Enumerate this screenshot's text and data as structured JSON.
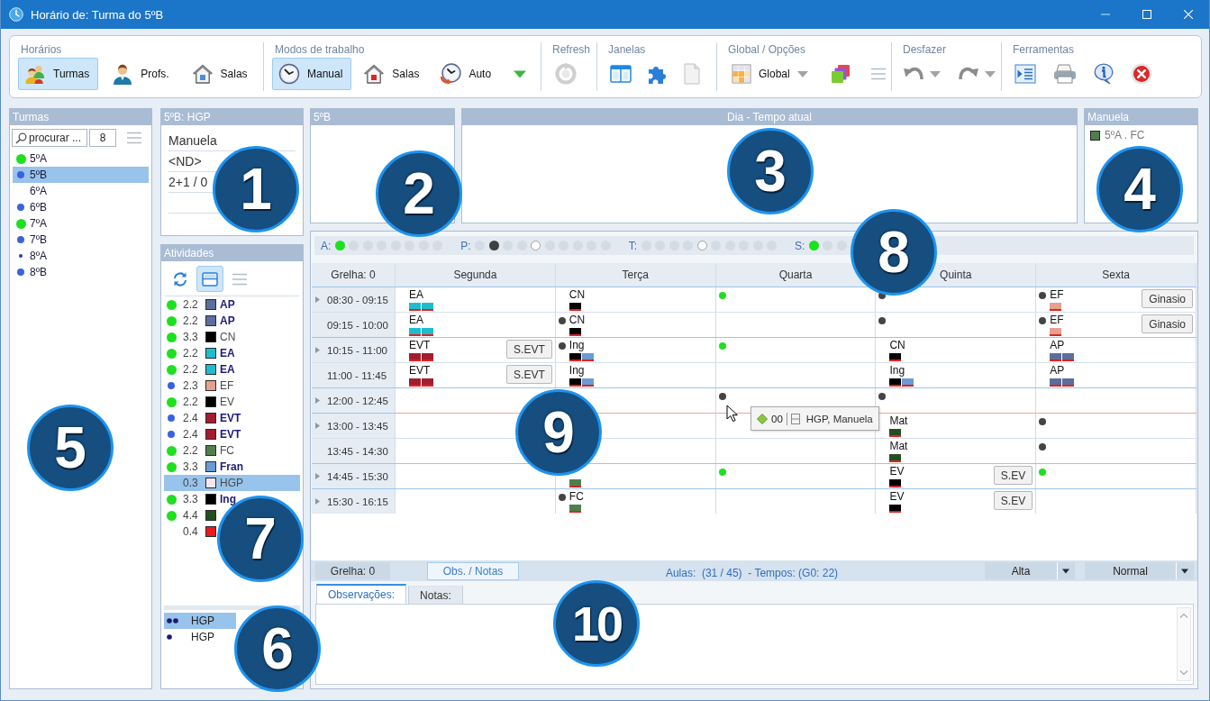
{
  "window": {
    "title": "Horário de: Turma do 5ºB"
  },
  "ribbon": [
    {
      "title": "Horários",
      "buttons": [
        {
          "label": "Turmas",
          "selected": true
        },
        {
          "label": "Profs.",
          "selected": false
        },
        {
          "label": "Salas",
          "selected": false
        }
      ]
    },
    {
      "title": "Modos de trabalho",
      "buttons": [
        {
          "label": "Manual",
          "selected": true
        },
        {
          "label": "Salas",
          "selected": false
        },
        {
          "label": "Auto",
          "selected": false
        }
      ]
    },
    {
      "title": "Refresh"
    },
    {
      "title": "Janelas"
    },
    {
      "title": "Global / Opções",
      "buttons": [
        {
          "label": "Global"
        }
      ]
    },
    {
      "title": "Desfazer"
    },
    {
      "title": "Ferramentas"
    }
  ],
  "classes_panel": {
    "title": "Turmas",
    "callout": "5",
    "search": {
      "placeholder": "procurar ..."
    },
    "count": "8",
    "items": [
      {
        "label": "5ºA",
        "selected": false,
        "dot": {
          "kind": "large",
          "color": "#1ee01e"
        }
      },
      {
        "label": "5ºB",
        "selected": true,
        "dot": {
          "kind": "medium",
          "color": "#3a62e0"
        }
      },
      {
        "label": "6ºA",
        "selected": false
      },
      {
        "label": "6ºB",
        "selected": false,
        "dot": {
          "kind": "medium",
          "color": "#3a62e0"
        }
      },
      {
        "label": "7ºA",
        "selected": false,
        "dot": {
          "kind": "large",
          "color": "#1ee01e"
        }
      },
      {
        "label": "7ºB",
        "selected": false,
        "dot": {
          "kind": "medium",
          "color": "#3a62e0"
        }
      },
      {
        "label": "8ºA",
        "selected": false,
        "dot": {
          "kind": "tiny",
          "color": "#2a3a9a"
        }
      },
      {
        "label": "8ºB",
        "selected": false,
        "dot": {
          "kind": "medium",
          "color": "#3a62e0"
        }
      }
    ]
  },
  "class_info": {
    "title": "5ºB: HGP",
    "callout": "1",
    "lines": [
      "Manuela",
      "<ND>",
      "2+1 / 0"
    ]
  },
  "activities": {
    "title": "Atividades",
    "callout": "7",
    "teachers_callout": "6",
    "toolbar": [
      {
        "selected": false
      },
      {
        "selected": true
      },
      {
        "selected": false
      }
    ],
    "items": [
      {
        "dot": {
          "kind": "large",
          "color": "#1ee01e"
        },
        "value": "2.2",
        "color": "#5d6d9d",
        "label": "AP",
        "bold": true,
        "selected": false
      },
      {
        "dot": {
          "kind": "large",
          "color": "#1ee01e"
        },
        "value": "2.2",
        "color": "#5d6d9d",
        "label": "AP",
        "bold": true,
        "selected": false
      },
      {
        "dot": {
          "kind": "large",
          "color": "#1ee01e"
        },
        "value": "3.3",
        "color": "#000000",
        "label": "CN",
        "bold": false,
        "selected": false
      },
      {
        "dot": {
          "kind": "large",
          "color": "#1ee01e"
        },
        "value": "2.2",
        "color": "#1fbcd0",
        "label": "EA",
        "bold": true,
        "selected": false
      },
      {
        "dot": {
          "kind": "large",
          "color": "#1ee01e"
        },
        "value": "2.2",
        "color": "#1fbcd0",
        "label": "EA",
        "bold": true,
        "selected": false
      },
      {
        "dot": {
          "kind": "medium",
          "color": "#3a62e0"
        },
        "value": "2.3",
        "color": "#e5a090",
        "label": "EF",
        "bold": false,
        "selected": false
      },
      {
        "dot": {
          "kind": "large",
          "color": "#1ee01e"
        },
        "value": "2.2",
        "color": "#000000",
        "label": "EV",
        "bold": false,
        "selected": false
      },
      {
        "dot": {
          "kind": "medium",
          "color": "#3a62e0"
        },
        "value": "2.4",
        "color": "#a31c30",
        "label": "EVT",
        "bold": true,
        "selected": false
      },
      {
        "dot": {
          "kind": "medium",
          "color": "#3a62e0"
        },
        "value": "2.4",
        "color": "#a31c30",
        "label": "EVT",
        "bold": true,
        "selected": false
      },
      {
        "dot": {
          "kind": "large",
          "color": "#1ee01e"
        },
        "value": "2.2",
        "color": "#4f7f4f",
        "label": "FC",
        "bold": false,
        "selected": false
      },
      {
        "dot": {
          "kind": "large",
          "color": "#1ee01e"
        },
        "value": "3.3",
        "color": "#6a9bd6",
        "label": "Fran",
        "bold": true,
        "selected": false
      },
      {
        "value": "0.3",
        "color": "#f5e6ee",
        "label": "HGP",
        "bold": false,
        "selected": true
      },
      {
        "dot": {
          "kind": "large",
          "color": "#1ee01e"
        },
        "value": "3.3",
        "color": "#000000",
        "label": "Ing",
        "bold": true,
        "selected": false
      },
      {
        "dot": {
          "kind": "large",
          "color": "#1ee01e"
        },
        "value": "4.4",
        "color": "#224f22",
        "selected": false
      },
      {
        "value": "0.4",
        "color": "#e81a1a",
        "selected": false
      }
    ],
    "teachers": [
      {
        "label": "HGP",
        "kind": "double",
        "selected": true
      },
      {
        "label": "HGP",
        "kind": "single",
        "selected": false
      }
    ]
  },
  "group_panel": {
    "title": "5ºB",
    "callout": "2"
  },
  "day_panel": {
    "title": "Dia - Tempo atual",
    "callout": "3"
  },
  "teacher_panel": {
    "title": "Manuela",
    "callout": "4",
    "items": [
      {
        "label": "5ºA . FC",
        "color": "#4f7f4f"
      }
    ]
  },
  "schedule": {
    "occupancy": {
      "callout": "8",
      "groups": [
        {
          "label": "A:",
          "dots": [
            {
              "color": "#1ee01e",
              "hollow": false
            },
            {
              "color": "#d5dbe3",
              "hollow": false
            },
            {
              "color": "#d5dbe3",
              "hollow": false
            },
            {
              "color": "#d5dbe3",
              "hollow": false
            },
            {
              "color": "#d5dbe3",
              "hollow": false
            },
            {
              "color": "#d5dbe3",
              "hollow": false
            },
            {
              "color": "#d5dbe3",
              "hollow": false
            },
            {
              "color": "#d5dbe3",
              "hollow": false
            }
          ]
        },
        {
          "label": "P:",
          "dots": [
            {
              "color": "#d5dbe3",
              "hollow": false
            },
            {
              "color": "#404040",
              "hollow": false
            },
            {
              "color": "#d5dbe3",
              "hollow": false
            },
            {
              "color": "#d5dbe3",
              "hollow": false
            },
            {
              "color": "#ffffff",
              "hollow": true
            },
            {
              "color": "#d5dbe3",
              "hollow": false
            },
            {
              "color": "#d5dbe3",
              "hollow": false
            },
            {
              "color": "#d5dbe3",
              "hollow": false
            },
            {
              "color": "#d5dbe3",
              "hollow": false
            },
            {
              "color": "#d5dbe3",
              "hollow": false
            }
          ]
        },
        {
          "label": "T:",
          "dots": [
            {
              "color": "#d5dbe3",
              "hollow": false
            },
            {
              "color": "#d5dbe3",
              "hollow": false
            },
            {
              "color": "#d5dbe3",
              "hollow": false
            },
            {
              "color": "#d5dbe3",
              "hollow": false
            },
            {
              "color": "#ffffff",
              "hollow": true
            },
            {
              "color": "#d5dbe3",
              "hollow": false
            },
            {
              "color": "#d5dbe3",
              "hollow": false
            },
            {
              "color": "#d5dbe3",
              "hollow": false
            },
            {
              "color": "#d5dbe3",
              "hollow": false
            },
            {
              "color": "#d5dbe3",
              "hollow": false
            }
          ]
        },
        {
          "label": "S:",
          "dots": [
            {
              "color": "#1ee01e",
              "hollow": false
            },
            {
              "color": "#d5dbe3",
              "hollow": false
            },
            {
              "color": "#d5dbe3",
              "hollow": false
            }
          ]
        }
      ]
    },
    "grid": {
      "callout": "9",
      "corner": "Grelha: 0",
      "days": [
        "Segunda",
        "Terça",
        "Quarta",
        "Quinta",
        "Sexta"
      ],
      "rows": [
        {
          "time": "08:30 - 09:15",
          "block_start": true,
          "line_after": false,
          "cells": [
            {
              "subject": "EA",
              "swatches": [
                {
                  "color": "#1fbcd0"
                },
                {
                  "color": "#1fbcd0"
                }
              ]
            },
            {
              "subject": "CN",
              "swatches": [
                {
                  "color": "#000000"
                }
              ]
            },
            {
              "dot": {
                "color": "#22dd22"
              }
            },
            {
              "dot": {
                "color": "#444444"
              }
            },
            {
              "dot": {
                "color": "#444444"
              },
              "subject": "EF",
              "swatches": [
                {
                  "color": "#e5a090"
                }
              ],
              "room": "Ginasio"
            }
          ]
        },
        {
          "time": "09:15 - 10:00",
          "block_start": false,
          "line_after": false,
          "cells": [
            {
              "subject": "EA",
              "swatches": [
                {
                  "color": "#1fbcd0"
                },
                {
                  "color": "#1fbcd0"
                }
              ]
            },
            {
              "dot": {
                "color": "#444444"
              },
              "subject": "CN",
              "swatches": [
                {
                  "color": "#000000"
                }
              ]
            },
            {},
            {
              "dot": {
                "color": "#444444"
              }
            },
            {
              "dot": {
                "color": "#444444"
              },
              "subject": "EF",
              "swatches": [
                {
                  "color": "#e5a090"
                }
              ],
              "room": "Ginasio"
            }
          ]
        },
        {
          "time": "10:15 - 11:00",
          "block_start": true,
          "line_after": false,
          "cells": [
            {
              "subject": "EVT",
              "swatches": [
                {
                  "color": "#a31c30"
                },
                {
                  "color": "#a31c30"
                }
              ],
              "room": "S.EVT"
            },
            {
              "dot": {
                "color": "#444444"
              },
              "subject": "Ing",
              "swatches": [
                {
                  "color": "#000000"
                },
                {
                  "color": "#6a9bd6"
                }
              ]
            },
            {
              "dot": {
                "color": "#22dd22"
              }
            },
            {
              "subject": "CN",
              "swatches": [
                {
                  "color": "#000000"
                }
              ]
            },
            {
              "subject": "AP",
              "swatches": [
                {
                  "color": "#5d6d9d"
                },
                {
                  "color": "#5d6d9d"
                }
              ]
            }
          ]
        },
        {
          "time": "11:00 - 11:45",
          "block_start": false,
          "line_after": false,
          "cells": [
            {
              "subject": "EVT",
              "swatches": [
                {
                  "color": "#a31c30"
                },
                {
                  "color": "#a31c30"
                }
              ],
              "room": "S.EVT"
            },
            {
              "subject": "Ing",
              "swatches": [
                {
                  "color": "#000000"
                },
                {
                  "color": "#6a9bd6"
                }
              ]
            },
            {},
            {
              "subject": "Ing",
              "swatches": [
                {
                  "color": "#000000"
                },
                {
                  "color": "#6a9bd6"
                }
              ]
            },
            {
              "subject": "AP",
              "swatches": [
                {
                  "color": "#5d6d9d"
                },
                {
                  "color": "#5d6d9d"
                }
              ]
            }
          ]
        },
        {
          "time": "12:00 - 12:45",
          "block_start": true,
          "line_after": true,
          "cells": [
            {},
            {},
            {
              "dot": {
                "color": "#444444"
              }
            },
            {
              "dot": {
                "color": "#444444"
              }
            },
            {}
          ]
        },
        {
          "time": "13:00 - 13:45",
          "block_start": true,
          "line_after": false,
          "cells": [
            {},
            {},
            {},
            {
              "subject": "Mat",
              "swatches": [
                {
                  "color": "#224f22"
                }
              ]
            },
            {
              "dot": {
                "color": "#444444"
              }
            }
          ]
        },
        {
          "time": "13:45 - 14:30",
          "block_start": false,
          "line_after": false,
          "cells": [
            {},
            {},
            {},
            {
              "subject": "Mat",
              "swatches": [
                {
                  "color": "#224f22"
                }
              ]
            },
            {
              "dot": {
                "color": "#444444"
              }
            }
          ]
        },
        {
          "time": "14:45 - 15:30",
          "block_start": true,
          "line_after": false,
          "cells": [
            {},
            {
              "swatches": [
                {
                  "color": "#4f7f4f"
                }
              ]
            },
            {
              "dot": {
                "color": "#22dd22"
              }
            },
            {
              "subject": "EV",
              "swatches": [
                {
                  "color": "#000000"
                }
              ],
              "room": "S.EV"
            },
            {
              "dot": {
                "color": "#22dd22"
              }
            }
          ]
        },
        {
          "time": "15:30 - 16:15",
          "block_start": true,
          "line_after": false,
          "cells": [
            {},
            {
              "dot": {
                "color": "#444444"
              },
              "subject": "FC",
              "swatches": [
                {
                  "color": "#4f7f4f"
                }
              ]
            },
            {},
            {
              "subject": "EV",
              "swatches": [
                {
                  "color": "#000000"
                }
              ],
              "room": "S.EV"
            },
            {}
          ]
        }
      ]
    },
    "tooltip": {
      "code": "00",
      "text": "HGP, Manuela"
    },
    "footer": {
      "grid_label": "Grelha: 0",
      "notes_button": "Obs. / Notas",
      "summary": "Aulas:  (31 / 45)  - Tempos: (G0: 22)",
      "dropdowns": [
        "Alta",
        "Normal"
      ]
    },
    "notes": {
      "callout": "10",
      "tabs": [
        {
          "label": "Observações:",
          "selected": true
        },
        {
          "label": "Notas:",
          "selected": false
        }
      ]
    }
  }
}
